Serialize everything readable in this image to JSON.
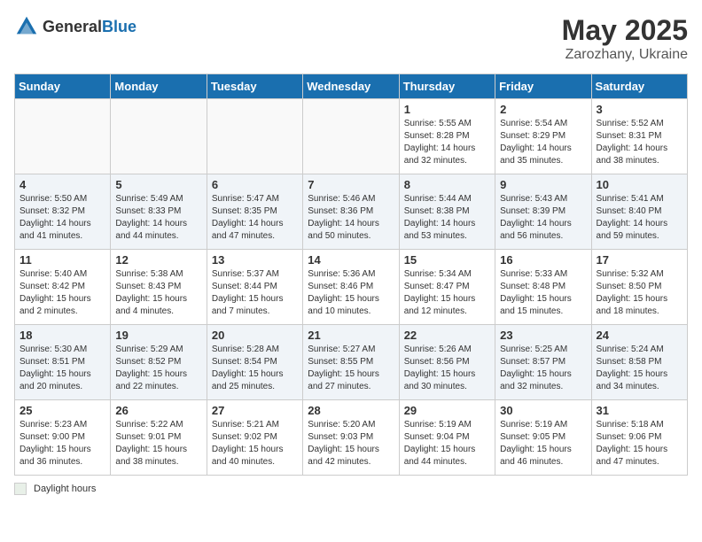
{
  "logo": {
    "general": "General",
    "blue": "Blue"
  },
  "title": {
    "month": "May 2025",
    "location": "Zarozhany, Ukraine"
  },
  "weekdays": [
    "Sunday",
    "Monday",
    "Tuesday",
    "Wednesday",
    "Thursday",
    "Friday",
    "Saturday"
  ],
  "footer": {
    "legend_label": "Daylight hours"
  },
  "weeks": [
    {
      "days": [
        {
          "num": "",
          "info": ""
        },
        {
          "num": "",
          "info": ""
        },
        {
          "num": "",
          "info": ""
        },
        {
          "num": "",
          "info": ""
        },
        {
          "num": "1",
          "info": "Sunrise: 5:55 AM\nSunset: 8:28 PM\nDaylight: 14 hours\nand 32 minutes."
        },
        {
          "num": "2",
          "info": "Sunrise: 5:54 AM\nSunset: 8:29 PM\nDaylight: 14 hours\nand 35 minutes."
        },
        {
          "num": "3",
          "info": "Sunrise: 5:52 AM\nSunset: 8:31 PM\nDaylight: 14 hours\nand 38 minutes."
        }
      ]
    },
    {
      "days": [
        {
          "num": "4",
          "info": "Sunrise: 5:50 AM\nSunset: 8:32 PM\nDaylight: 14 hours\nand 41 minutes."
        },
        {
          "num": "5",
          "info": "Sunrise: 5:49 AM\nSunset: 8:33 PM\nDaylight: 14 hours\nand 44 minutes."
        },
        {
          "num": "6",
          "info": "Sunrise: 5:47 AM\nSunset: 8:35 PM\nDaylight: 14 hours\nand 47 minutes."
        },
        {
          "num": "7",
          "info": "Sunrise: 5:46 AM\nSunset: 8:36 PM\nDaylight: 14 hours\nand 50 minutes."
        },
        {
          "num": "8",
          "info": "Sunrise: 5:44 AM\nSunset: 8:38 PM\nDaylight: 14 hours\nand 53 minutes."
        },
        {
          "num": "9",
          "info": "Sunrise: 5:43 AM\nSunset: 8:39 PM\nDaylight: 14 hours\nand 56 minutes."
        },
        {
          "num": "10",
          "info": "Sunrise: 5:41 AM\nSunset: 8:40 PM\nDaylight: 14 hours\nand 59 minutes."
        }
      ]
    },
    {
      "days": [
        {
          "num": "11",
          "info": "Sunrise: 5:40 AM\nSunset: 8:42 PM\nDaylight: 15 hours\nand 2 minutes."
        },
        {
          "num": "12",
          "info": "Sunrise: 5:38 AM\nSunset: 8:43 PM\nDaylight: 15 hours\nand 4 minutes."
        },
        {
          "num": "13",
          "info": "Sunrise: 5:37 AM\nSunset: 8:44 PM\nDaylight: 15 hours\nand 7 minutes."
        },
        {
          "num": "14",
          "info": "Sunrise: 5:36 AM\nSunset: 8:46 PM\nDaylight: 15 hours\nand 10 minutes."
        },
        {
          "num": "15",
          "info": "Sunrise: 5:34 AM\nSunset: 8:47 PM\nDaylight: 15 hours\nand 12 minutes."
        },
        {
          "num": "16",
          "info": "Sunrise: 5:33 AM\nSunset: 8:48 PM\nDaylight: 15 hours\nand 15 minutes."
        },
        {
          "num": "17",
          "info": "Sunrise: 5:32 AM\nSunset: 8:50 PM\nDaylight: 15 hours\nand 18 minutes."
        }
      ]
    },
    {
      "days": [
        {
          "num": "18",
          "info": "Sunrise: 5:30 AM\nSunset: 8:51 PM\nDaylight: 15 hours\nand 20 minutes."
        },
        {
          "num": "19",
          "info": "Sunrise: 5:29 AM\nSunset: 8:52 PM\nDaylight: 15 hours\nand 22 minutes."
        },
        {
          "num": "20",
          "info": "Sunrise: 5:28 AM\nSunset: 8:54 PM\nDaylight: 15 hours\nand 25 minutes."
        },
        {
          "num": "21",
          "info": "Sunrise: 5:27 AM\nSunset: 8:55 PM\nDaylight: 15 hours\nand 27 minutes."
        },
        {
          "num": "22",
          "info": "Sunrise: 5:26 AM\nSunset: 8:56 PM\nDaylight: 15 hours\nand 30 minutes."
        },
        {
          "num": "23",
          "info": "Sunrise: 5:25 AM\nSunset: 8:57 PM\nDaylight: 15 hours\nand 32 minutes."
        },
        {
          "num": "24",
          "info": "Sunrise: 5:24 AM\nSunset: 8:58 PM\nDaylight: 15 hours\nand 34 minutes."
        }
      ]
    },
    {
      "days": [
        {
          "num": "25",
          "info": "Sunrise: 5:23 AM\nSunset: 9:00 PM\nDaylight: 15 hours\nand 36 minutes."
        },
        {
          "num": "26",
          "info": "Sunrise: 5:22 AM\nSunset: 9:01 PM\nDaylight: 15 hours\nand 38 minutes."
        },
        {
          "num": "27",
          "info": "Sunrise: 5:21 AM\nSunset: 9:02 PM\nDaylight: 15 hours\nand 40 minutes."
        },
        {
          "num": "28",
          "info": "Sunrise: 5:20 AM\nSunset: 9:03 PM\nDaylight: 15 hours\nand 42 minutes."
        },
        {
          "num": "29",
          "info": "Sunrise: 5:19 AM\nSunset: 9:04 PM\nDaylight: 15 hours\nand 44 minutes."
        },
        {
          "num": "30",
          "info": "Sunrise: 5:19 AM\nSunset: 9:05 PM\nDaylight: 15 hours\nand 46 minutes."
        },
        {
          "num": "31",
          "info": "Sunrise: 5:18 AM\nSunset: 9:06 PM\nDaylight: 15 hours\nand 47 minutes."
        }
      ]
    }
  ]
}
